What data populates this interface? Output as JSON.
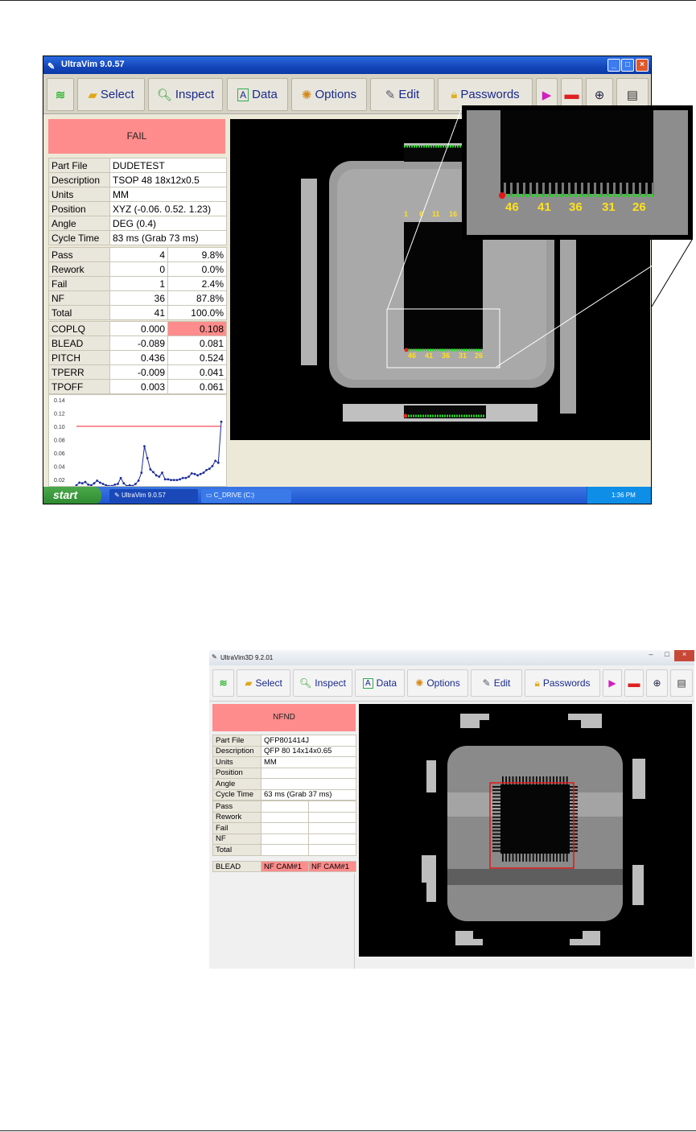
{
  "screen1": {
    "title": "UltraVim 9.0.57",
    "toolbar": {
      "select": "Select",
      "inspect": "Inspect",
      "data": "Data",
      "options": "Options",
      "edit": "Edit",
      "passwords": "Passwords"
    },
    "status": "FAIL",
    "info": [
      [
        "Part File",
        "DUDETEST"
      ],
      [
        "Description",
        "TSOP 48 18x12x0.5"
      ],
      [
        "Units",
        "MM"
      ],
      [
        "Position",
        "XYZ (-0.06. 0.52. 1.23)"
      ],
      [
        "Angle",
        "DEG (0.4)"
      ],
      [
        "Cycle Time",
        "83 ms (Grab 73 ms)"
      ]
    ],
    "counts": [
      [
        "Pass",
        "4",
        "9.8%"
      ],
      [
        "Rework",
        "0",
        "0.0%"
      ],
      [
        "Fail",
        "1",
        "2.4%"
      ],
      [
        "NF",
        "36",
        "87.8%"
      ],
      [
        "Total",
        "41",
        "100.0%"
      ]
    ],
    "measures": [
      [
        "COPLQ",
        "0.000",
        "0.108"
      ],
      [
        "BLEAD",
        "-0.089",
        "0.081"
      ],
      [
        "PITCH",
        "0.436",
        "0.524"
      ],
      [
        "TPERR",
        "-0.009",
        "0.041"
      ],
      [
        "TPOFF",
        "0.003",
        "0.061"
      ]
    ],
    "chart_data": {
      "type": "line",
      "ylabels": [
        "0.14",
        "0.12",
        "0.10",
        "0.08",
        "0.06",
        "0.04",
        "0.02"
      ],
      "ylim": [
        0.01,
        0.14
      ],
      "threshold": 0.1,
      "values": [
        0.011,
        0.015,
        0.014,
        0.016,
        0.012,
        0.011,
        0.014,
        0.018,
        0.015,
        0.013,
        0.011,
        0.01,
        0.01,
        0.012,
        0.013,
        0.022,
        0.014,
        0.01,
        0.011,
        0.01,
        0.013,
        0.018,
        0.03,
        0.07,
        0.052,
        0.035,
        0.031,
        0.026,
        0.024,
        0.03,
        0.02,
        0.02,
        0.019,
        0.019,
        0.019,
        0.02,
        0.022,
        0.022,
        0.024,
        0.029,
        0.028,
        0.026,
        0.028,
        0.03,
        0.034,
        0.036,
        0.04,
        0.048,
        0.045,
        0.107
      ]
    },
    "pin_labels": [
      "1",
      "6",
      "11",
      "16"
    ],
    "bottom_labels": [
      "46",
      "41",
      "36",
      "31",
      "26"
    ],
    "taskbar": {
      "start": "start",
      "task1": "UltraVim 9.0.57",
      "task2": "C_DRIVE (C:)",
      "clock": "1:36 PM"
    }
  },
  "screen2": {
    "title": "UltraVim3D 9.2.01",
    "toolbar": {
      "select": "Select",
      "inspect": "Inspect",
      "data": "Data",
      "options": "Options",
      "edit": "Edit",
      "passwords": "Passwords"
    },
    "status": "NFND",
    "info": [
      [
        "Part File",
        "QFP801414J"
      ],
      [
        "Description",
        "QFP 80 14x14x0.65"
      ],
      [
        "Units",
        "MM"
      ],
      [
        "Position",
        ""
      ],
      [
        "Angle",
        ""
      ],
      [
        "Cycle Time",
        "63 ms (Grab 37 ms)"
      ]
    ],
    "counts": [
      "Pass",
      "Rework",
      "Fail",
      "NF",
      "Total"
    ],
    "measure": {
      "label": "BLEAD",
      "v1": "NF CAM#1",
      "v2": "NF CAM#1"
    }
  }
}
